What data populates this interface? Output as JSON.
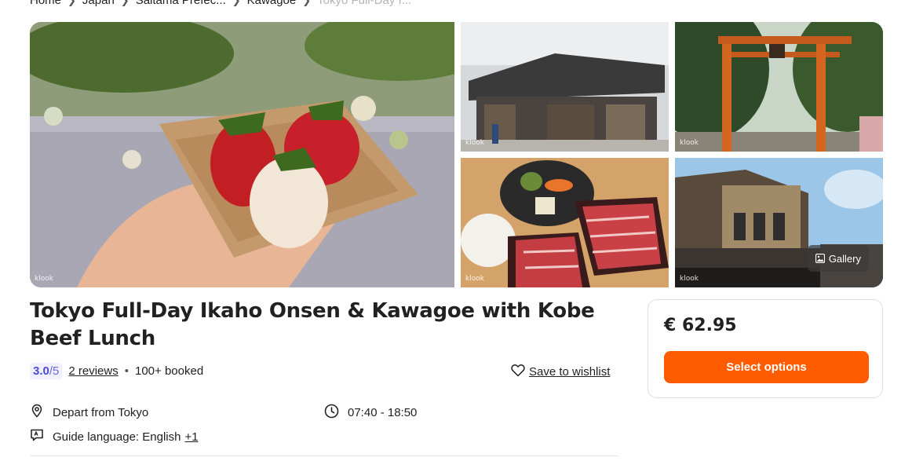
{
  "breadcrumb": {
    "items": [
      "Home",
      "Japan",
      "Saitama Prefec...",
      "Kawagoe"
    ],
    "current": "Tokyo Full-Day I..."
  },
  "gallery": {
    "button_label": "Gallery",
    "watermark": "klook",
    "images": [
      "strawberries-photo",
      "kawagoe-storehouse-street-photo",
      "torii-gate-photo",
      "kobe-beef-sukiyaki-photo",
      "kawagoe-historic-building-photo"
    ]
  },
  "activity": {
    "title": "Tokyo Full-Day Ikaho Onsen & Kawagoe with Kobe Beef Lunch",
    "rating": "3.0",
    "rating_scale": "/5",
    "reviews": "2 reviews",
    "booked": "100+ booked",
    "wishlist_label": "Save to wishlist",
    "depart": "Depart from Tokyo",
    "time": "07:40 - 18:50",
    "language_label": "Guide language: English",
    "language_more": "+1"
  },
  "booking": {
    "price": "€ 62.95",
    "select_label": "Select options"
  },
  "colors": {
    "accent": "#ff5b00",
    "rating_bg": "#f0f0ff",
    "rating_text": "#4b4bd6"
  },
  "icons": [
    "chevron-right-icon",
    "heart-icon",
    "location-pin-icon",
    "clock-icon",
    "speech-bubble-icon",
    "image-icon"
  ]
}
